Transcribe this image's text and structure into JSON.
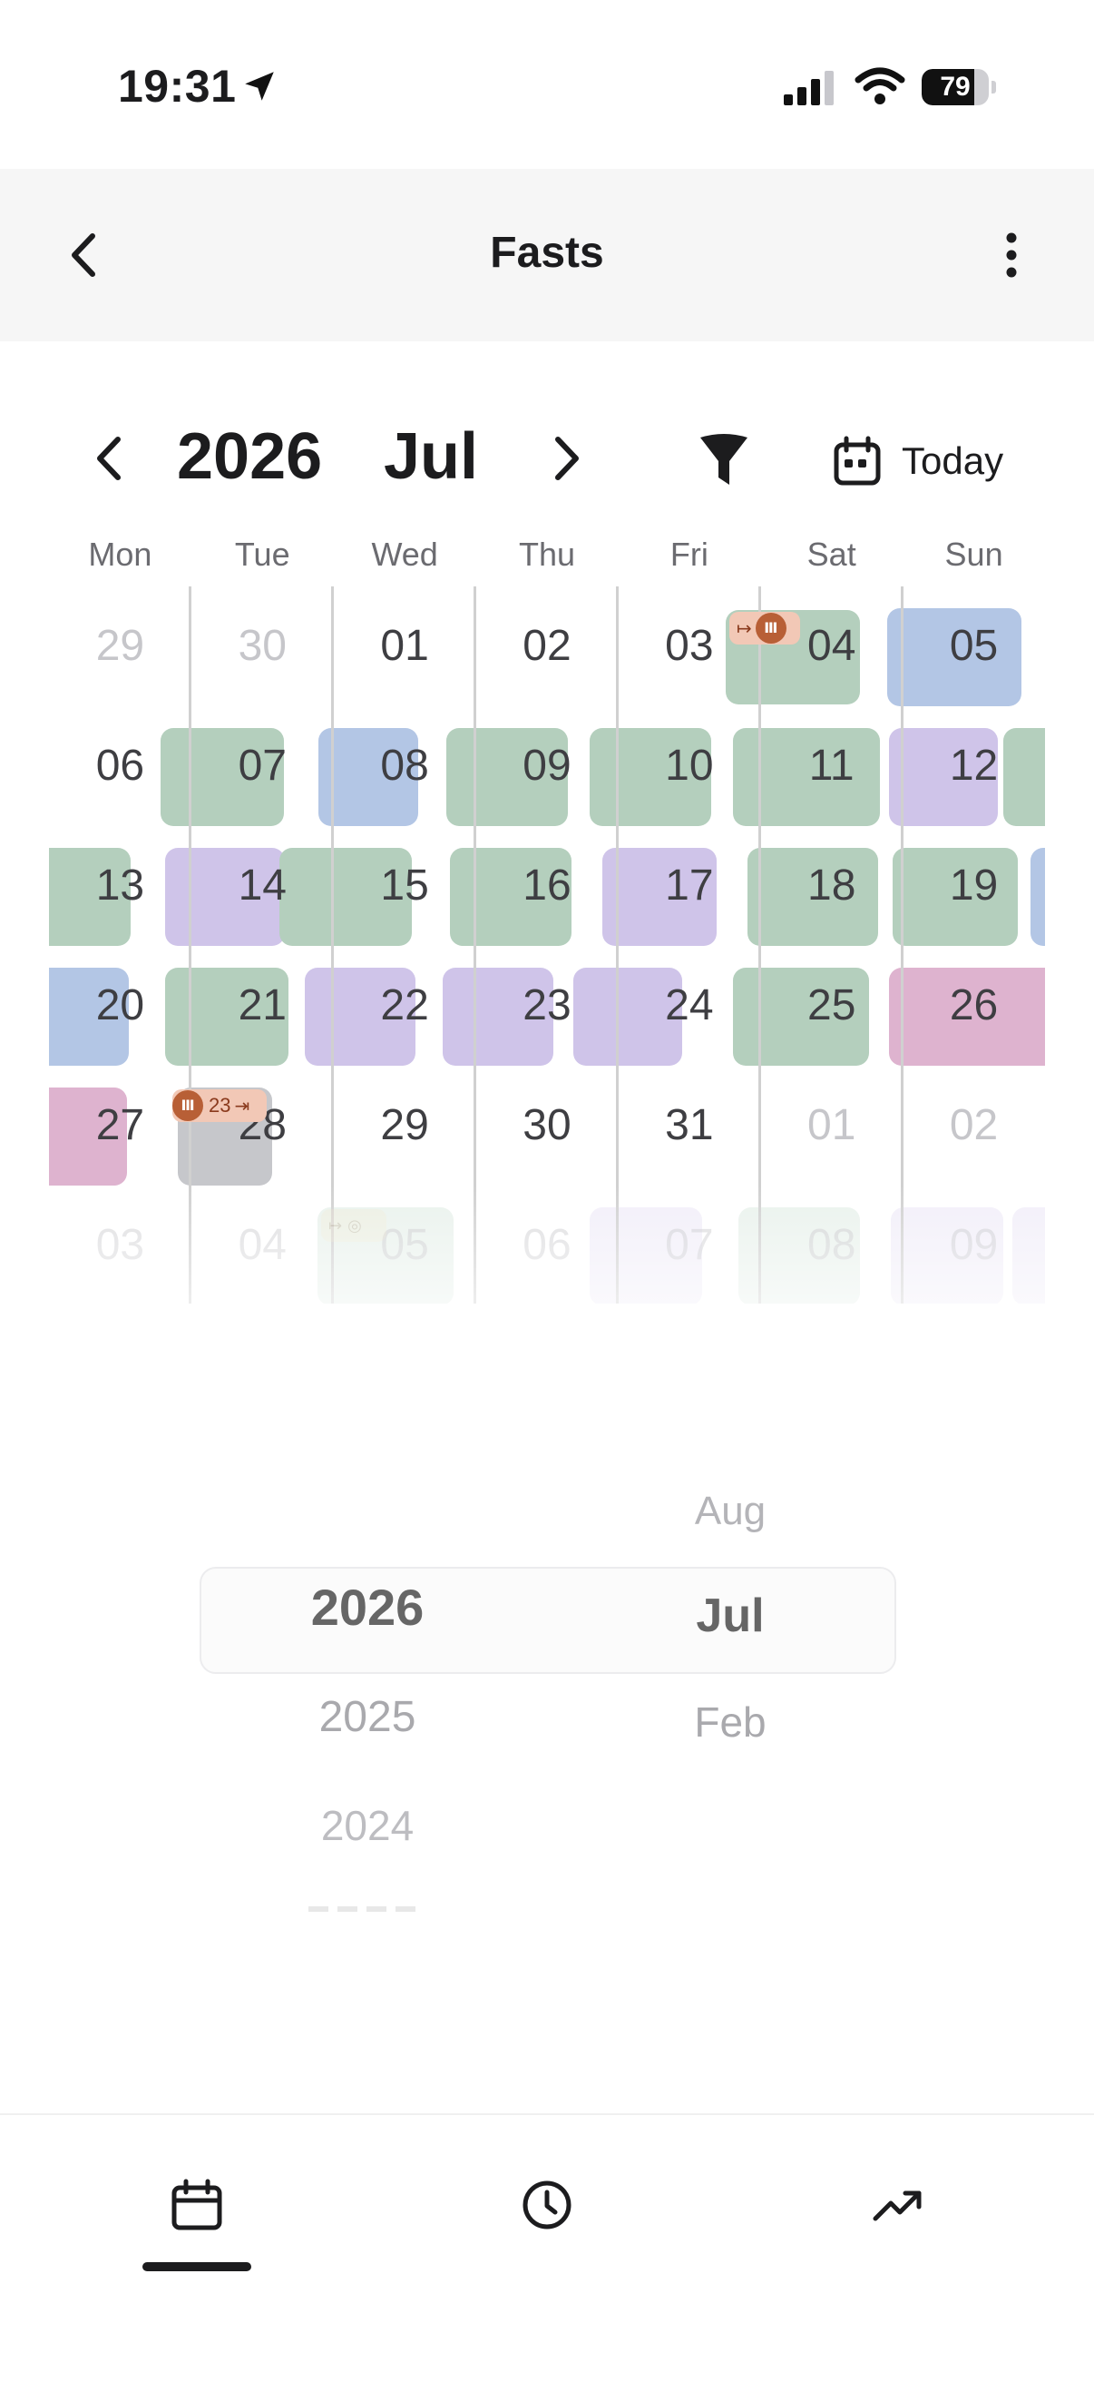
{
  "status_bar": {
    "time": "19:31",
    "battery": "79",
    "battery_level": 0.79
  },
  "nav": {
    "title": "Fasts"
  },
  "toolbar": {
    "year": "2026",
    "month": "Jul",
    "today_label": "Today"
  },
  "weekdays": [
    "Mon",
    "Tue",
    "Wed",
    "Thu",
    "Fri",
    "Sat",
    "Sun"
  ],
  "calendar": {
    "weeks": [
      [
        {
          "d": "29",
          "in": false
        },
        {
          "d": "30",
          "in": false
        },
        {
          "d": "01",
          "in": true
        },
        {
          "d": "02",
          "in": true
        },
        {
          "d": "03",
          "in": true
        },
        {
          "d": "04",
          "in": true
        },
        {
          "d": "05",
          "in": true
        }
      ],
      [
        {
          "d": "06",
          "in": true
        },
        {
          "d": "07",
          "in": true
        },
        {
          "d": "08",
          "in": true
        },
        {
          "d": "09",
          "in": true
        },
        {
          "d": "10",
          "in": true
        },
        {
          "d": "11",
          "in": true
        },
        {
          "d": "12",
          "in": true
        }
      ],
      [
        {
          "d": "13",
          "in": true
        },
        {
          "d": "14",
          "in": true
        },
        {
          "d": "15",
          "in": true
        },
        {
          "d": "16",
          "in": true
        },
        {
          "d": "17",
          "in": true
        },
        {
          "d": "18",
          "in": true
        },
        {
          "d": "19",
          "in": true
        }
      ],
      [
        {
          "d": "20",
          "in": true
        },
        {
          "d": "21",
          "in": true
        },
        {
          "d": "22",
          "in": true
        },
        {
          "d": "23",
          "in": true
        },
        {
          "d": "24",
          "in": true
        },
        {
          "d": "25",
          "in": true
        },
        {
          "d": "26",
          "in": true
        }
      ],
      [
        {
          "d": "27",
          "in": true
        },
        {
          "d": "28",
          "in": true
        },
        {
          "d": "29",
          "in": true
        },
        {
          "d": "30",
          "in": true
        },
        {
          "d": "31",
          "in": true
        },
        {
          "d": "01",
          "in": false
        },
        {
          "d": "02",
          "in": false
        }
      ],
      [
        {
          "d": "03",
          "in": false
        },
        {
          "d": "04",
          "in": false
        },
        {
          "d": "05",
          "in": false
        },
        {
          "d": "06",
          "in": false
        },
        {
          "d": "07",
          "in": false
        },
        {
          "d": "08",
          "in": false
        },
        {
          "d": "09",
          "in": false
        }
      ]
    ],
    "ongoing_badge_count": "23",
    "colors": {
      "green": "#b4cfbd",
      "blue": "#b3c6e5",
      "purple": "#cfc4e9",
      "pink": "#deb3cf",
      "gray": "#c6c7cb",
      "badge": "#f2c8b6",
      "badge_dot": "#b85f36"
    }
  },
  "picker": {
    "years": [
      "2026",
      "2025",
      "2024"
    ],
    "months": [
      "Aug",
      "Jul",
      "Feb"
    ],
    "selected_year": "2026",
    "selected_month": "Jul"
  },
  "tabs": [
    {
      "name": "calendar",
      "icon": "calendar-icon",
      "active": true
    },
    {
      "name": "timer",
      "icon": "clock-icon",
      "active": false
    },
    {
      "name": "stats",
      "icon": "trend-up-icon",
      "active": false
    }
  ]
}
